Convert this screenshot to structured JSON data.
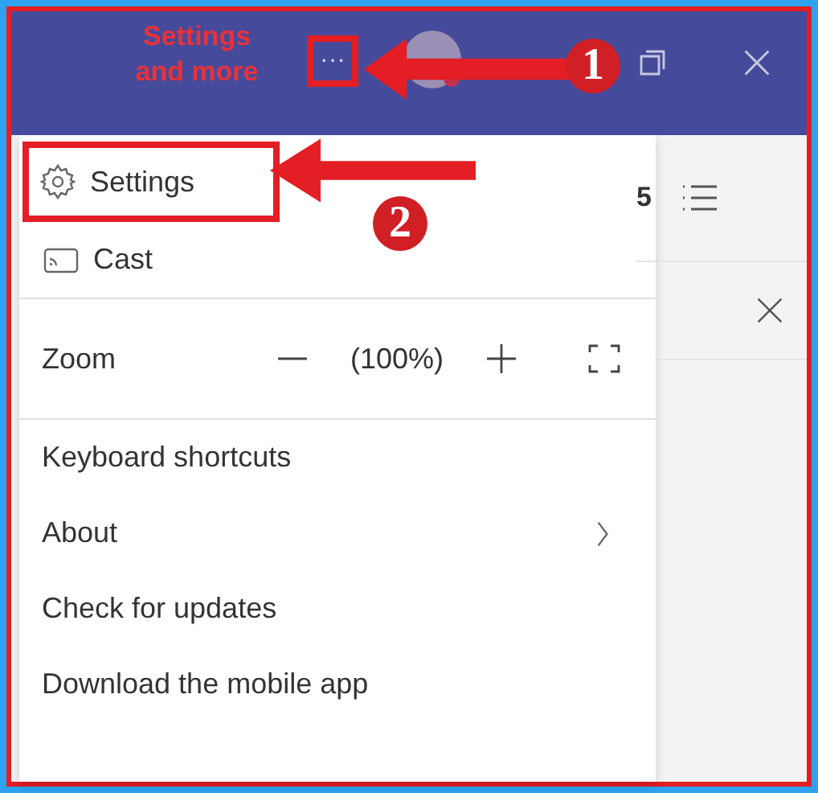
{
  "title_bar": {
    "menu_button": "···"
  },
  "background": {
    "count": "5"
  },
  "menu": {
    "items": [
      {
        "kind": "gear",
        "label": "Settings",
        "highlighted": true
      },
      {
        "kind": "cast",
        "label": "Cast",
        "highlighted": false
      },
      {
        "kind": "zoom",
        "label": "Zoom",
        "value": "(100%)"
      },
      {
        "kind": "plain",
        "label": "Keyboard shortcuts"
      },
      {
        "kind": "chevron",
        "label": "About"
      },
      {
        "kind": "plain",
        "label": "Check for updates"
      },
      {
        "kind": "plain",
        "label": "Download the mobile app"
      }
    ]
  },
  "annotations": [
    {
      "text": "Settings and more",
      "number": "1"
    },
    {
      "number": "2"
    }
  ]
}
